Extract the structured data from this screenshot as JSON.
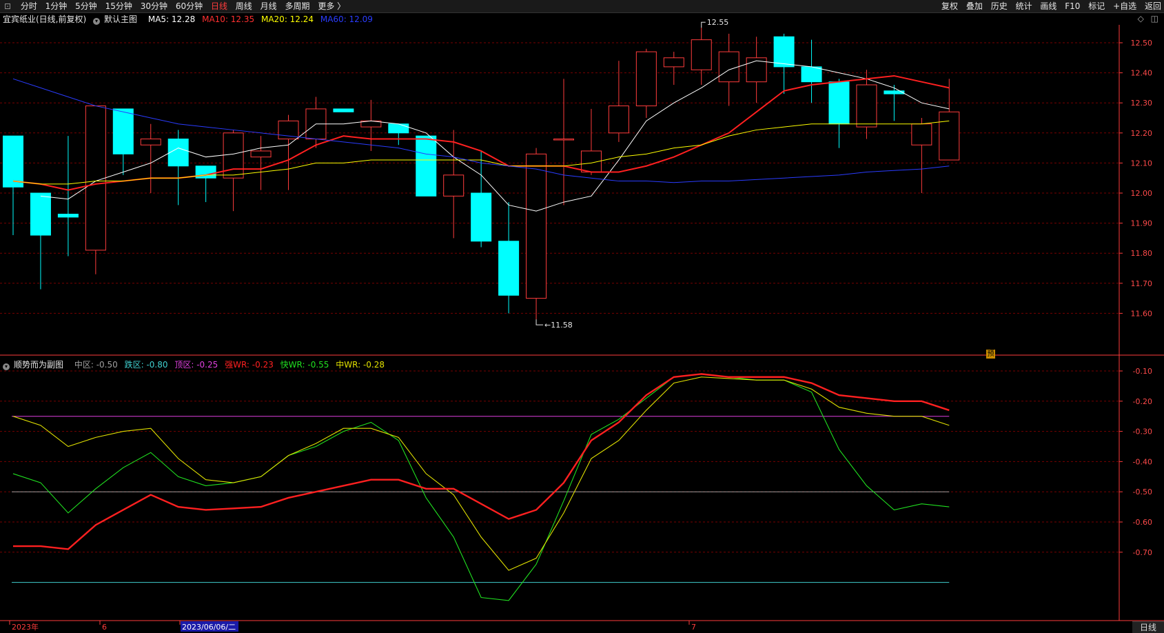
{
  "toolbar": {
    "logo_glyph": "⊡",
    "periods": [
      "分时",
      "1分钟",
      "5分钟",
      "15分钟",
      "30分钟",
      "60分钟",
      "日线",
      "周线",
      "月线",
      "多周期",
      "更多 〉"
    ],
    "selected_period": "日线",
    "right_items": [
      "复权",
      "叠加",
      "历史",
      "统计",
      "画线",
      "F10",
      "标记",
      "+自选",
      "返回"
    ]
  },
  "main_legend": {
    "title": "宜宾纸业(日线,前复权)",
    "template": "默认主图",
    "ma": [
      {
        "label": "MA5: 12.28",
        "color": "#ffffff"
      },
      {
        "label": "MA10: 12.35",
        "color": "#ff3030"
      },
      {
        "label": "MA20: 12.24",
        "color": "#ffff00"
      },
      {
        "label": "MA60: 12.09",
        "color": "#2a3cff"
      }
    ]
  },
  "sub_legend": {
    "title": "顺势而为副图",
    "items": [
      {
        "label": "中区: -0.50",
        "color": "#a0a0a0"
      },
      {
        "label": "跌区: -0.80",
        "color": "#40d0d0"
      },
      {
        "label": "顶区: -0.25",
        "color": "#e040e0"
      },
      {
        "label": "强WR: -0.23",
        "color": "#ff2020"
      },
      {
        "label": "快WR: -0.55",
        "color": "#20e020"
      },
      {
        "label": "中WR: -0.28",
        "color": "#e0e000"
      }
    ]
  },
  "top_right_icons": [
    "◇",
    "◫"
  ],
  "annotations": {
    "high": "12.55",
    "low": "11.58"
  },
  "prediction_marker": "预",
  "bottom_tab": "日线",
  "date_axis": [
    {
      "label": "2023年",
      "color": "#ff3c3c"
    },
    {
      "label": "6",
      "color": "#ff3c3c"
    },
    {
      "label": "2023/06/06/二",
      "color": "#ffffff"
    },
    {
      "label": "7",
      "color": "#ff3c3c"
    }
  ],
  "colors": {
    "up": "#ff3c3c",
    "down": "#00ffff",
    "grid": "#7a0000",
    "axis": "#ff3c3c"
  },
  "chart_data": [
    {
      "type": "candlestick",
      "title": "宜宾纸业(日线,前复权)",
      "ylim": [
        11.55,
        12.55
      ],
      "yticks": [
        "12.50",
        "12.40",
        "12.30",
        "12.20",
        "12.10",
        "12.00",
        "11.90",
        "11.80",
        "11.70",
        "11.60"
      ],
      "candles": [
        [
          12.19,
          12.02,
          12.02,
          11.86
        ],
        [
          12.0,
          11.86,
          12.0,
          11.68
        ],
        [
          11.93,
          11.92,
          12.19,
          11.79
        ],
        [
          11.81,
          12.29,
          12.29,
          11.73
        ],
        [
          12.28,
          12.13,
          12.28,
          12.06
        ],
        [
          12.16,
          12.18,
          12.23,
          12.0
        ],
        [
          12.18,
          12.09,
          12.21,
          11.96
        ],
        [
          12.09,
          12.05,
          12.09,
          11.97
        ],
        [
          12.05,
          12.2,
          12.21,
          11.94
        ],
        [
          12.12,
          12.14,
          12.19,
          12.01
        ],
        [
          12.18,
          12.24,
          12.26,
          12.01
        ],
        [
          12.18,
          12.28,
          12.32,
          12.15
        ],
        [
          12.28,
          12.27,
          12.28,
          12.27
        ],
        [
          12.22,
          12.24,
          12.31,
          12.14
        ],
        [
          12.23,
          12.2,
          12.23,
          12.16
        ],
        [
          12.19,
          11.99,
          12.19,
          11.99
        ],
        [
          11.99,
          12.06,
          12.21,
          11.85
        ],
        [
          12.0,
          11.84,
          12.14,
          11.82
        ],
        [
          11.84,
          11.66,
          11.97,
          11.6
        ],
        [
          11.65,
          12.13,
          12.15,
          11.58
        ],
        [
          12.18,
          12.18,
          12.38,
          11.96
        ],
        [
          12.07,
          12.14,
          12.28,
          12.06
        ],
        [
          12.2,
          12.29,
          12.44,
          12.17
        ],
        [
          12.29,
          12.47,
          12.48,
          12.25
        ],
        [
          12.42,
          12.45,
          12.47,
          12.36
        ],
        [
          12.41,
          12.51,
          12.55,
          12.36
        ],
        [
          12.37,
          12.47,
          12.53,
          12.29
        ],
        [
          12.37,
          12.45,
          12.52,
          12.3
        ],
        [
          12.52,
          12.42,
          12.53,
          12.33
        ],
        [
          12.42,
          12.37,
          12.51,
          12.3
        ],
        [
          12.37,
          12.23,
          12.38,
          12.15
        ],
        [
          12.22,
          12.36,
          12.41,
          12.18
        ],
        [
          12.34,
          12.33,
          12.36,
          12.24
        ],
        [
          12.16,
          12.23,
          12.25,
          12.0
        ],
        [
          12.11,
          12.27,
          12.38,
          12.11
        ]
      ],
      "ma": [
        {
          "name": "MA5",
          "color": "#ffffff",
          "values": [
            null,
            11.99,
            11.98,
            12.04,
            12.07,
            12.1,
            12.15,
            12.12,
            12.13,
            12.15,
            12.16,
            12.23,
            12.23,
            12.24,
            12.23,
            12.2,
            12.12,
            12.06,
            11.96,
            11.94,
            11.97,
            11.99,
            12.11,
            12.24,
            12.3,
            12.35,
            12.41,
            12.44,
            12.43,
            12.42,
            12.4,
            12.38,
            12.35,
            12.3,
            12.28
          ]
        },
        {
          "name": "MA10",
          "color": "#ff2020",
          "values": [
            12.04,
            12.03,
            12.01,
            12.03,
            12.04,
            12.05,
            12.05,
            12.06,
            12.08,
            12.08,
            12.11,
            12.16,
            12.19,
            12.18,
            12.18,
            12.18,
            12.17,
            12.14,
            12.09,
            12.09,
            12.09,
            12.07,
            12.07,
            12.09,
            12.12,
            12.16,
            12.2,
            12.27,
            12.34,
            12.36,
            12.37,
            12.38,
            12.39,
            12.37,
            12.35
          ]
        },
        {
          "name": "MA20",
          "color": "#ffff00",
          "values": [
            12.04,
            12.03,
            12.03,
            12.04,
            12.04,
            12.05,
            12.05,
            12.06,
            12.06,
            12.07,
            12.08,
            12.1,
            12.1,
            12.11,
            12.11,
            12.11,
            12.11,
            12.11,
            12.09,
            12.09,
            12.09,
            12.1,
            12.12,
            12.13,
            12.15,
            12.16,
            12.19,
            12.21,
            12.22,
            12.23,
            12.23,
            12.23,
            12.23,
            12.23,
            12.24
          ]
        },
        {
          "name": "MA60",
          "color": "#2a3cff",
          "values": [
            12.38,
            12.35,
            12.32,
            12.29,
            12.27,
            12.25,
            12.23,
            12.22,
            12.21,
            12.2,
            12.19,
            12.18,
            12.17,
            12.16,
            12.15,
            12.13,
            12.12,
            12.1,
            12.09,
            12.08,
            12.06,
            12.05,
            12.04,
            12.04,
            12.035,
            12.04,
            12.04,
            12.045,
            12.05,
            12.055,
            12.06,
            12.07,
            12.075,
            12.08,
            12.09
          ]
        }
      ]
    },
    {
      "type": "line",
      "title": "顺势而为副图",
      "ylim": [
        -0.87,
        -0.06
      ],
      "yticks": [
        "-0.10",
        "-0.20",
        "-0.30",
        "-0.40",
        "-0.50",
        "-0.60",
        "-0.70"
      ],
      "reference_lines": [
        {
          "name": "顶区",
          "value": -0.25,
          "color": "#e040e0"
        },
        {
          "name": "中区",
          "value": -0.5,
          "color": "#a0a0a0"
        },
        {
          "name": "跌区",
          "value": -0.8,
          "color": "#40d0d0"
        }
      ],
      "series": [
        {
          "name": "强WR",
          "color": "#ff2020",
          "width": 2.4,
          "values": [
            -0.68,
            -0.68,
            -0.69,
            -0.61,
            -0.56,
            -0.51,
            -0.55,
            -0.56,
            -0.555,
            -0.55,
            -0.52,
            -0.5,
            -0.48,
            -0.46,
            -0.46,
            -0.49,
            -0.49,
            -0.54,
            -0.59,
            -0.56,
            -0.47,
            -0.33,
            -0.27,
            -0.18,
            -0.12,
            -0.11,
            -0.12,
            -0.12,
            -0.12,
            -0.14,
            -0.18,
            -0.19,
            -0.2,
            -0.2,
            -0.23
          ]
        },
        {
          "name": "快WR",
          "color": "#20e020",
          "width": 1.1,
          "values": [
            -0.44,
            -0.47,
            -0.57,
            -0.49,
            -0.42,
            -0.37,
            -0.45,
            -0.48,
            -0.47,
            -0.45,
            -0.38,
            -0.35,
            -0.3,
            -0.27,
            -0.33,
            -0.52,
            -0.65,
            -0.85,
            -0.86,
            -0.74,
            -0.53,
            -0.31,
            -0.26,
            -0.19,
            -0.12,
            -0.11,
            -0.12,
            -0.13,
            -0.13,
            -0.17,
            -0.36,
            -0.48,
            -0.56,
            -0.54,
            -0.55
          ]
        },
        {
          "name": "中WR",
          "color": "#e0e000",
          "width": 1.1,
          "values": [
            -0.25,
            -0.28,
            -0.35,
            -0.32,
            -0.3,
            -0.29,
            -0.39,
            -0.46,
            -0.47,
            -0.45,
            -0.38,
            -0.34,
            -0.29,
            -0.29,
            -0.32,
            -0.44,
            -0.51,
            -0.65,
            -0.76,
            -0.72,
            -0.57,
            -0.39,
            -0.33,
            -0.23,
            -0.14,
            -0.12,
            -0.125,
            -0.13,
            -0.13,
            -0.16,
            -0.22,
            -0.24,
            -0.25,
            -0.25,
            -0.28
          ]
        }
      ]
    }
  ]
}
